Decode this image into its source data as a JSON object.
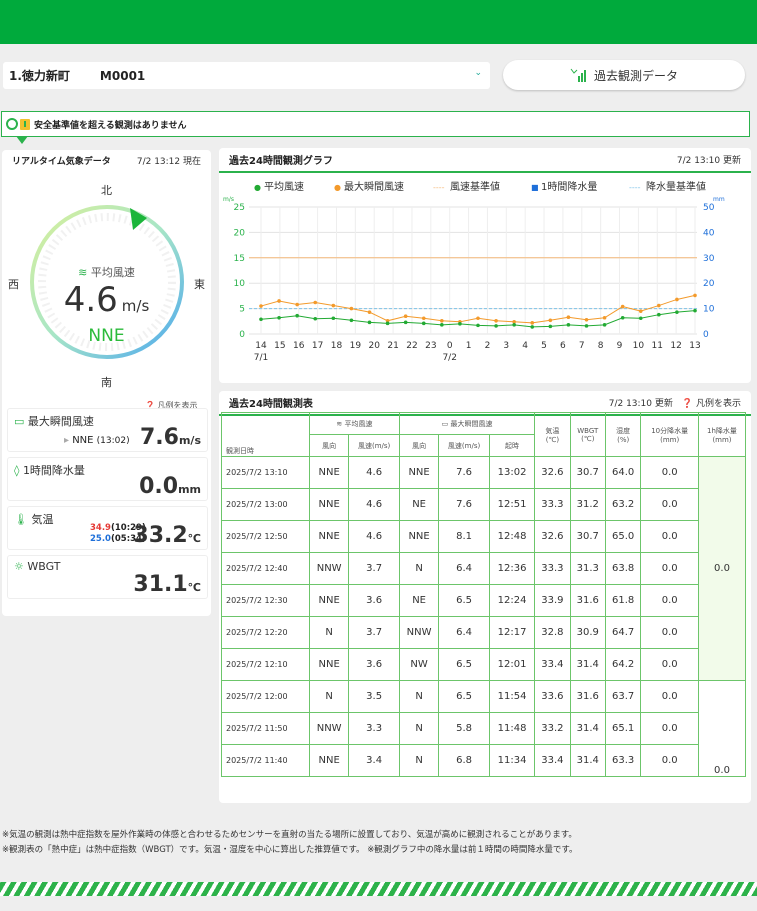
{
  "station": {
    "name": "1.徳力新町",
    "code": "M0001"
  },
  "past_button": "過去観測データ",
  "alert": "安全基準値を超える観測はありません",
  "realtime": {
    "title": "リアルタイム気象データ",
    "time": "7/2 13:12 現在",
    "dirs": {
      "n": "北",
      "s": "南",
      "e": "東",
      "w": "西"
    },
    "wind_label": "平均風速",
    "wind_value": "4.6",
    "wind_unit": "m/s",
    "wind_dir": "NNE",
    "legend_link": "凡例を表示",
    "gust": {
      "label": "最大瞬間風速",
      "dir": "NNE",
      "time": "(13:02)",
      "value": "7.6",
      "unit": "m/s"
    },
    "rain": {
      "label": "1時間降水量",
      "value": "0.0",
      "unit": "mm"
    },
    "temp": {
      "label": "気温",
      "max": "34.9",
      "max_time": "(10:29)",
      "min": "25.0",
      "min_time": "(05:34)",
      "value": "33.2",
      "unit": "℃"
    },
    "wbgt": {
      "label": "WBGT",
      "value": "31.1",
      "unit": "℃"
    }
  },
  "graph": {
    "title": "過去24時間観測グラフ",
    "updated": "7/2 13:10 更新"
  },
  "chart_data": {
    "type": "line",
    "legend": [
      "平均風速",
      "最大瞬間風速",
      "風速基準値",
      "1時間降水量",
      "降水量基準値"
    ],
    "y_left_label": "m/s",
    "y_right_label": "mm",
    "ylim_left": [
      0,
      25
    ],
    "ylim_right": [
      0,
      50
    ],
    "yticks_left": [
      0,
      5,
      10,
      15,
      20,
      25
    ],
    "yticks_right": [
      0,
      10,
      20,
      30,
      40,
      50
    ],
    "x_ticks": [
      "14",
      "15",
      "16",
      "17",
      "18",
      "19",
      "20",
      "21",
      "22",
      "23",
      "0",
      "1",
      "2",
      "3",
      "4",
      "5",
      "6",
      "7",
      "8",
      "9",
      "10",
      "11",
      "12",
      "13"
    ],
    "x_date_labels": [
      {
        "at": "14",
        "text": "7/1"
      },
      {
        "at": "0",
        "text": "7/2"
      }
    ],
    "wind_threshold": 15,
    "rain_threshold": 10,
    "avg_wind": [
      2.9,
      3.2,
      3.6,
      3.0,
      3.1,
      2.7,
      2.3,
      2.1,
      2.3,
      2.1,
      1.8,
      2.0,
      1.7,
      1.6,
      1.8,
      1.4,
      1.5,
      1.8,
      1.6,
      1.8,
      3.2,
      3.1,
      3.8,
      4.3,
      4.6
    ],
    "max_gust": [
      5.5,
      6.5,
      5.8,
      6.2,
      5.6,
      5.0,
      4.3,
      2.6,
      3.5,
      3.1,
      2.6,
      2.4,
      3.1,
      2.6,
      2.4,
      2.2,
      2.7,
      3.3,
      2.8,
      3.2,
      5.4,
      4.5,
      5.6,
      6.8,
      7.6
    ],
    "rain_1h": [
      0,
      0,
      0,
      0,
      0,
      0,
      0,
      0,
      0,
      0,
      0,
      0,
      0,
      0,
      0,
      0,
      0,
      0,
      0,
      0,
      0,
      0,
      0,
      0,
      0
    ],
    "colors": {
      "avg": "#22aa33",
      "gust": "#f39a2b",
      "threshold": "#f5b97a",
      "rain": "#1e6fd9",
      "rain_threshold": "#7ec3e8"
    }
  },
  "table": {
    "title": "過去24時間観測表",
    "updated": "7/2 13:10 更新",
    "legend_link": "凡例を表示",
    "group_avg": "平均風速",
    "group_max": "最大瞬間風速",
    "h_datetime": "観測日時",
    "h_dir": "風向",
    "h_speed": "風速(m/s)",
    "h_time": "起時",
    "h_temp": "気温\n(℃)",
    "h_wbgt": "WBGT\n(℃)",
    "h_hum": "湿度\n(%)",
    "h_rain10": "10分降水量\n(mm)",
    "h_rain1h": "1h降水量\n(mm)",
    "rows": [
      [
        "2025/7/2 13:10",
        "NNE",
        "4.6",
        "NNE",
        "7.6",
        "13:02",
        "32.6",
        "30.7",
        "64.0",
        "0.0"
      ],
      [
        "2025/7/2 13:00",
        "NNE",
        "4.6",
        "NE",
        "7.6",
        "12:51",
        "33.3",
        "31.2",
        "63.2",
        "0.0"
      ],
      [
        "2025/7/2 12:50",
        "NNE",
        "4.6",
        "NNE",
        "8.1",
        "12:48",
        "32.6",
        "30.7",
        "65.0",
        "0.0"
      ],
      [
        "2025/7/2 12:40",
        "NNW",
        "3.7",
        "N",
        "6.4",
        "12:36",
        "33.3",
        "31.3",
        "63.8",
        "0.0"
      ],
      [
        "2025/7/2 12:30",
        "NNE",
        "3.6",
        "NE",
        "6.5",
        "12:24",
        "33.9",
        "31.6",
        "61.8",
        "0.0"
      ],
      [
        "2025/7/2 12:20",
        "N",
        "3.7",
        "NNW",
        "6.4",
        "12:17",
        "32.8",
        "30.9",
        "64.7",
        "0.0"
      ],
      [
        "2025/7/2 12:10",
        "NNE",
        "3.6",
        "NW",
        "6.5",
        "12:01",
        "33.4",
        "31.4",
        "64.2",
        "0.0"
      ],
      [
        "2025/7/2 12:00",
        "N",
        "3.5",
        "N",
        "6.5",
        "11:54",
        "33.6",
        "31.6",
        "63.7",
        "0.0"
      ],
      [
        "2025/7/2 11:50",
        "NNW",
        "3.3",
        "N",
        "5.8",
        "11:48",
        "33.2",
        "31.4",
        "65.1",
        "0.0"
      ],
      [
        "2025/7/2 11:40",
        "NNE",
        "3.4",
        "N",
        "6.8",
        "11:34",
        "33.4",
        "31.4",
        "63.3",
        "0.0"
      ]
    ],
    "rain1h_a": "0.0",
    "rain1h_b": "0.0"
  },
  "notes": [
    "※気温の観測は熱中症指数を屋外作業時の体感と合わせるためセンサーを直射の当たる場所に設置しており、気温が高めに観測されることがあります。",
    "※観測表の「熱中症」は熱中症指数（WBGT）です。気温・湿度を中心に算出した推算値です。 ※観測グラフ中の降水量は前１時間の時間降水量です。"
  ]
}
